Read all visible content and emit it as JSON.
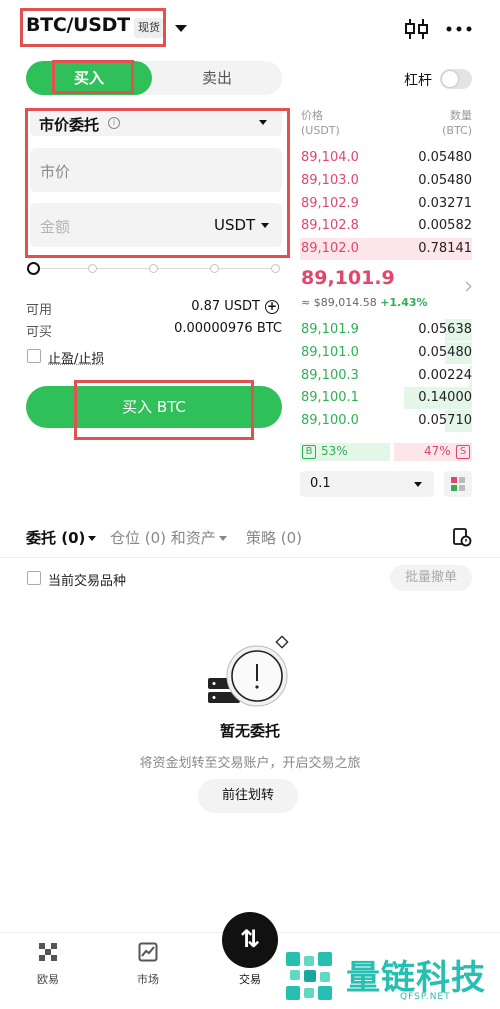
{
  "header": {
    "pair": "BTC/USDT",
    "badge": "现货"
  },
  "toggle": {
    "buy": "买入",
    "sell": "卖出",
    "leverage": "杠杆"
  },
  "form": {
    "order_type": "市价委托",
    "price_placeholder": "市价",
    "amount_placeholder": "金额",
    "amount_unit": "USDT",
    "slider_value": 0,
    "available_label": "可用",
    "available_value": "0.87 USDT",
    "buyable_label": "可买",
    "buyable_value": "0.00000976 BTC",
    "tpsl_label": "止盈/止损",
    "submit": "买入 BTC"
  },
  "orderbook": {
    "price_header": "价格",
    "price_unit": "(USDT)",
    "qty_header": "数量",
    "qty_unit": "(BTC)",
    "asks": [
      {
        "price": "89,104.0",
        "qty": "0.05480",
        "depth": 0
      },
      {
        "price": "89,103.0",
        "qty": "0.05480",
        "depth": 0
      },
      {
        "price": "89,102.9",
        "qty": "0.03271",
        "depth": 0
      },
      {
        "price": "89,102.8",
        "qty": "0.00582",
        "depth": 0
      },
      {
        "price": "89,102.0",
        "qty": "0.78141",
        "depth": 1.0
      }
    ],
    "last_price": "89,101.9",
    "ref_price": "≈ $89,014.58",
    "ref_change": "+1.43%",
    "bids": [
      {
        "price": "89,101.9",
        "qty": "0.05638",
        "depth": 0.4
      },
      {
        "price": "89,101.0",
        "qty": "0.05480",
        "depth": 0.4
      },
      {
        "price": "89,100.3",
        "qty": "0.00224",
        "depth": 0.05
      },
      {
        "price": "89,100.1",
        "qty": "0.14000",
        "depth": 1.0
      },
      {
        "price": "89,100.0",
        "qty": "0.05710",
        "depth": 0.4
      }
    ],
    "buy_ratio": "53%",
    "sell_ratio": "47%",
    "buy_badge": "B",
    "sell_badge": "S",
    "depth_step": "0.1"
  },
  "tabs": {
    "orders": "委托 (0)",
    "positions": "仓位 (0) 和资产",
    "strategy": "策略 (0)"
  },
  "filters": {
    "current_only": "当前交易品种",
    "batch_cancel": "批量撤单"
  },
  "empty": {
    "title": "暂无委托",
    "desc": "将资金划转至交易账户，开启交易之旅",
    "button": "前往划转"
  },
  "nav": {
    "items": [
      "欧易",
      "市场",
      "交易"
    ]
  },
  "watermark": {
    "text": "量链科技",
    "sub": "QFSP.NET"
  },
  "colors": {
    "buy_green": "#30c05a",
    "ask_red": "#e0476a",
    "highlight_red": "#e15151",
    "watermark": "#27bfb2"
  }
}
